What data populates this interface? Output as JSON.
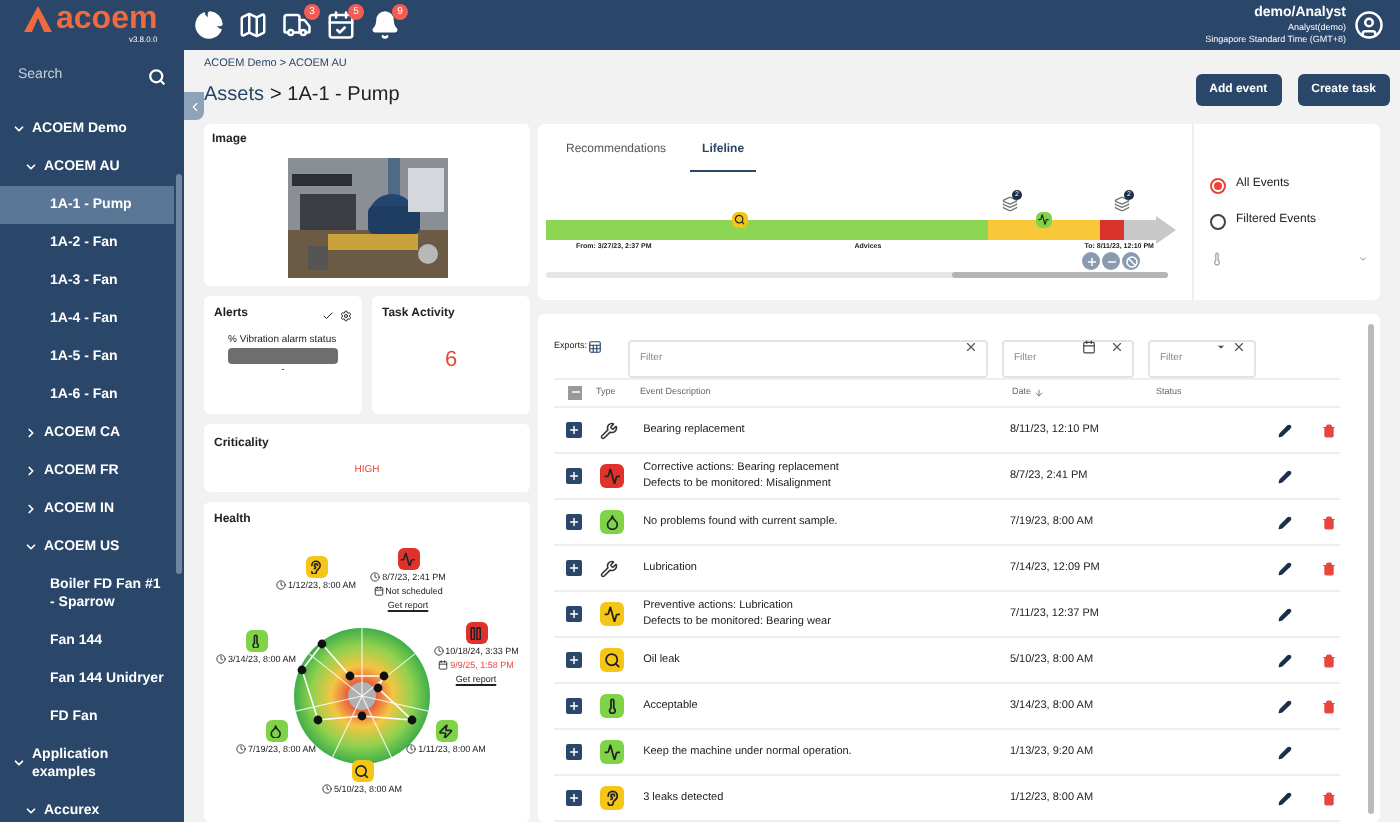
{
  "app": {
    "logo": "acoem",
    "version": "v3.8.0.0"
  },
  "topbar": {
    "icons": [
      {
        "kind": "pie"
      },
      {
        "kind": "map"
      },
      {
        "kind": "engine",
        "badge": "3"
      },
      {
        "kind": "calendar",
        "badge": "5"
      },
      {
        "kind": "bell",
        "badge": "9"
      }
    ],
    "user": {
      "name": "demo/Analyst",
      "role": "Analyst(demo)",
      "timezone": "Singapore Standard Time (GMT+8)"
    }
  },
  "sidebar": {
    "search": {
      "placeholder": "Search"
    },
    "tree": [
      {
        "label": "ACOEM Demo",
        "expanded": true,
        "selected": false,
        "children": [
          {
            "label": "ACOEM AU",
            "expanded": true,
            "selected": false,
            "children": [
              {
                "label": "1A-1 - Pump",
                "selected": true
              },
              {
                "label": "1A-2 - Fan",
                "selected": false
              },
              {
                "label": "1A-3 - Fan",
                "selected": false
              },
              {
                "label": "1A-4 - Fan",
                "selected": false
              },
              {
                "label": "1A-5 - Fan",
                "selected": false
              },
              {
                "label": "1A-6 - Fan",
                "selected": false
              }
            ]
          },
          {
            "label": "ACOEM CA",
            "expanded": false,
            "selected": false
          },
          {
            "label": "ACOEM FR",
            "expanded": false,
            "selected": false
          },
          {
            "label": "ACOEM IN",
            "expanded": false,
            "selected": false
          },
          {
            "label": "ACOEM US",
            "expanded": true,
            "selected": false,
            "children": [
              {
                "label": "Boiler FD Fan #1 - Sparrow",
                "selected": false
              },
              {
                "label": "Fan 144",
                "selected": false
              },
              {
                "label": "Fan 144 Unidryer",
                "selected": false
              },
              {
                "label": "FD Fan",
                "selected": false
              }
            ]
          }
        ]
      },
      {
        "label": "Application examples",
        "expanded": true,
        "selected": false,
        "children": [
          {
            "label": "Accurex",
            "expanded": true,
            "selected": false
          }
        ]
      }
    ]
  },
  "breadcrumb": "ACOEM Demo > ACOEM AU",
  "title": {
    "parent": "Assets",
    "name": "> 1A-1 - Pump"
  },
  "actions": [
    "Add event",
    "Create task"
  ],
  "image_card": {
    "title": "Image"
  },
  "alerts": {
    "title": "Alerts",
    "label": "% Vibration alarm status",
    "value": "-"
  },
  "task_activity": {
    "title": "Task Activity",
    "count": "6"
  },
  "criticality": {
    "title": "Criticality",
    "value": "HIGH"
  },
  "health": {
    "title": "Health",
    "items": [
      {
        "kind": "ear",
        "color": "#f5c518",
        "lines": [
          {
            "kind": "date",
            "text": "1/12/23, 8:00 AM",
            "alert": false
          }
        ]
      },
      {
        "kind": "wave",
        "color": "#e0312b",
        "lines": [
          {
            "kind": "date",
            "text": "8/7/23, 2:41 PM",
            "alert": false
          },
          {
            "kind": "schedule",
            "text": "Not scheduled",
            "alert": false
          },
          {
            "kind": "link",
            "text": "Get report",
            "alert": false
          }
        ]
      },
      {
        "kind": "pause",
        "color": "#e0312b",
        "lines": [
          {
            "kind": "date",
            "text": "10/18/24, 3:33 PM",
            "alert": false
          },
          {
            "kind": "schedule",
            "text": "9/9/25, 1:58 PM",
            "alert": true
          },
          {
            "kind": "link",
            "text": "Get report",
            "alert": false
          }
        ]
      },
      {
        "kind": "thermo",
        "color": "#7ed348",
        "lines": [
          {
            "kind": "date",
            "text": "3/14/23, 8:00 AM",
            "alert": false
          }
        ]
      },
      {
        "kind": "oil",
        "color": "#7ed348",
        "lines": [
          {
            "kind": "date",
            "text": "7/19/23, 8:00 AM",
            "alert": false
          }
        ]
      },
      {
        "kind": "search",
        "color": "#f5c518",
        "lines": [
          {
            "kind": "date",
            "text": "5/10/23, 8:00 AM",
            "alert": false
          }
        ]
      },
      {
        "kind": "zap",
        "color": "#7ed348",
        "lines": [
          {
            "kind": "date",
            "text": "1/11/23, 8:00 AM",
            "alert": false
          }
        ]
      }
    ]
  },
  "tabs": [
    {
      "label": "Recommendations",
      "selected": false
    },
    {
      "label": "Lifeline",
      "selected": true
    }
  ],
  "timeline": {
    "markers": [
      {
        "kind": "search",
        "color": "#f5c518"
      },
      {
        "kind": "stack",
        "badge": "2"
      },
      {
        "kind": "wave",
        "color": "#7ed348"
      },
      {
        "kind": "stack",
        "badge": "2"
      }
    ],
    "from": "From: 3/27/23, 2:37 PM",
    "middle": "Advices",
    "to": "To: 8/11/23, 12:10 PM"
  },
  "event_filter": [
    {
      "label": "All Events",
      "selected": true
    },
    {
      "label": "Filtered Events",
      "selected": false
    }
  ],
  "exports_label": "Exports:",
  "filters": [
    {
      "kind": "text",
      "placeholder": "Filter"
    },
    {
      "kind": "date",
      "placeholder": "Filter"
    },
    {
      "kind": "select",
      "placeholder": "Filter"
    }
  ],
  "table": {
    "columns": [
      "Type",
      "Event Description",
      "Date",
      "Status"
    ],
    "rows": [
      {
        "type": {
          "kind": "tools"
        },
        "description": [
          "Bearing replacement"
        ],
        "date": "8/11/23, 12:10 PM",
        "deletable": true
      },
      {
        "type": {
          "kind": "wave",
          "color": "#e0312b"
        },
        "description": [
          "Corrective actions: Bearing replacement",
          "Defects to be monitored: Misalignment"
        ],
        "date": "8/7/23, 2:41 PM",
        "deletable": false
      },
      {
        "type": {
          "kind": "oil",
          "color": "#7ed348"
        },
        "description": [
          "No problems found with current sample."
        ],
        "date": "7/19/23, 8:00 AM",
        "deletable": true
      },
      {
        "type": {
          "kind": "tools"
        },
        "description": [
          "Lubrication"
        ],
        "date": "7/14/23, 12:09 PM",
        "deletable": true
      },
      {
        "type": {
          "kind": "wave",
          "color": "#f5c518"
        },
        "description": [
          "Preventive actions: Lubrication",
          "Defects to be monitored: Bearing wear"
        ],
        "date": "7/11/23, 12:37 PM",
        "deletable": false
      },
      {
        "type": {
          "kind": "search",
          "color": "#f5c518"
        },
        "description": [
          "Oil leak"
        ],
        "date": "5/10/23, 8:00 AM",
        "deletable": true
      },
      {
        "type": {
          "kind": "thermo",
          "color": "#7ed348"
        },
        "description": [
          "Acceptable"
        ],
        "date": "3/14/23, 8:00 AM",
        "deletable": true
      },
      {
        "type": {
          "kind": "wave",
          "color": "#7ed348"
        },
        "description": [
          "Keep the machine under normal operation."
        ],
        "date": "1/13/23, 9:20 AM",
        "deletable": false
      },
      {
        "type": {
          "kind": "ear",
          "color": "#f5c518"
        },
        "description": [
          "3 leaks detected"
        ],
        "date": "1/12/23, 8:00 AM",
        "deletable": true
      }
    ]
  }
}
